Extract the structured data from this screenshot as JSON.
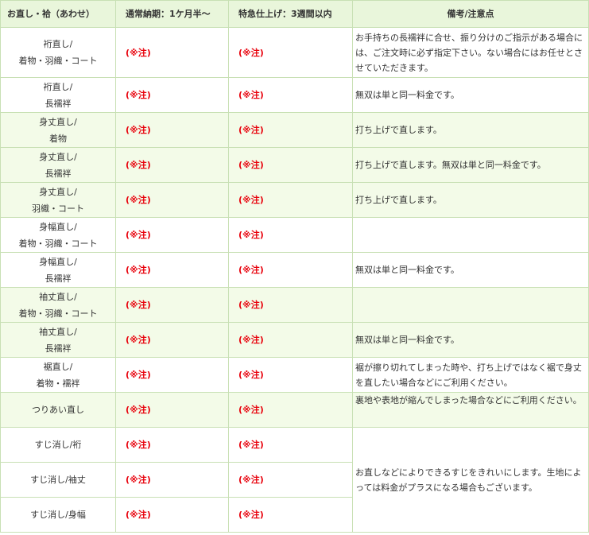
{
  "header": {
    "col1": "お直し・袷（あわせ）",
    "col2": "通常納期：1ケ月半～",
    "col3": "特急仕上げ：3週間以内",
    "col4": "備考/注意点"
  },
  "price_label": "(※注)",
  "rows": [
    {
      "line1": "裄直し/",
      "line2": "着物・羽織・コート",
      "note": "お手持ちの長襦袢に合せ、振り分けのご指示がある場合には、ご注文時に必ず指定下さい。ない場合にはお任せとさせていただきます。"
    },
    {
      "line1": "裄直し/",
      "line2": "長襦袢",
      "note": "無双は単と同一料金です。"
    },
    {
      "line1": "身丈直し/",
      "line2": "着物",
      "note": "打ち上げで直します。"
    },
    {
      "line1": "身丈直し/",
      "line2": "長襦袢",
      "note": "打ち上げで直します。無双は単と同一料金です。"
    },
    {
      "line1": "身丈直し/",
      "line2": "羽織・コート",
      "note": "打ち上げで直します。"
    },
    {
      "line1": "身幅直し/",
      "line2": "着物・羽織・コート",
      "note": ""
    },
    {
      "line1": "身幅直し/",
      "line2": "長襦袢",
      "note": "無双は単と同一料金です。"
    },
    {
      "line1": "袖丈直し/",
      "line2": "着物・羽織・コート",
      "note": ""
    },
    {
      "line1": "袖丈直し/",
      "line2": "長襦袢",
      "note": "無双は単と同一料金です。"
    },
    {
      "line1": "裾直し/",
      "line2": "着物・襦袢",
      "note": "裾が擦り切れてしまった時や、打ち上げではなく裾で身丈を直したい場合などにご利用ください。"
    },
    {
      "line1": "つりあい直し",
      "line2": "",
      "note": "裏地や表地が縮んでしまった場合などにご利用ください。"
    },
    {
      "line1": "すじ消し/裄",
      "line2": ""
    },
    {
      "line1": "すじ消し/袖丈",
      "line2": ""
    },
    {
      "line1": "すじ消し/身幅",
      "line2": ""
    }
  ],
  "merged_note": "お直しなどによりできるすじをきれいにします。生地によっては料金がプラスになる場合もございます。"
}
